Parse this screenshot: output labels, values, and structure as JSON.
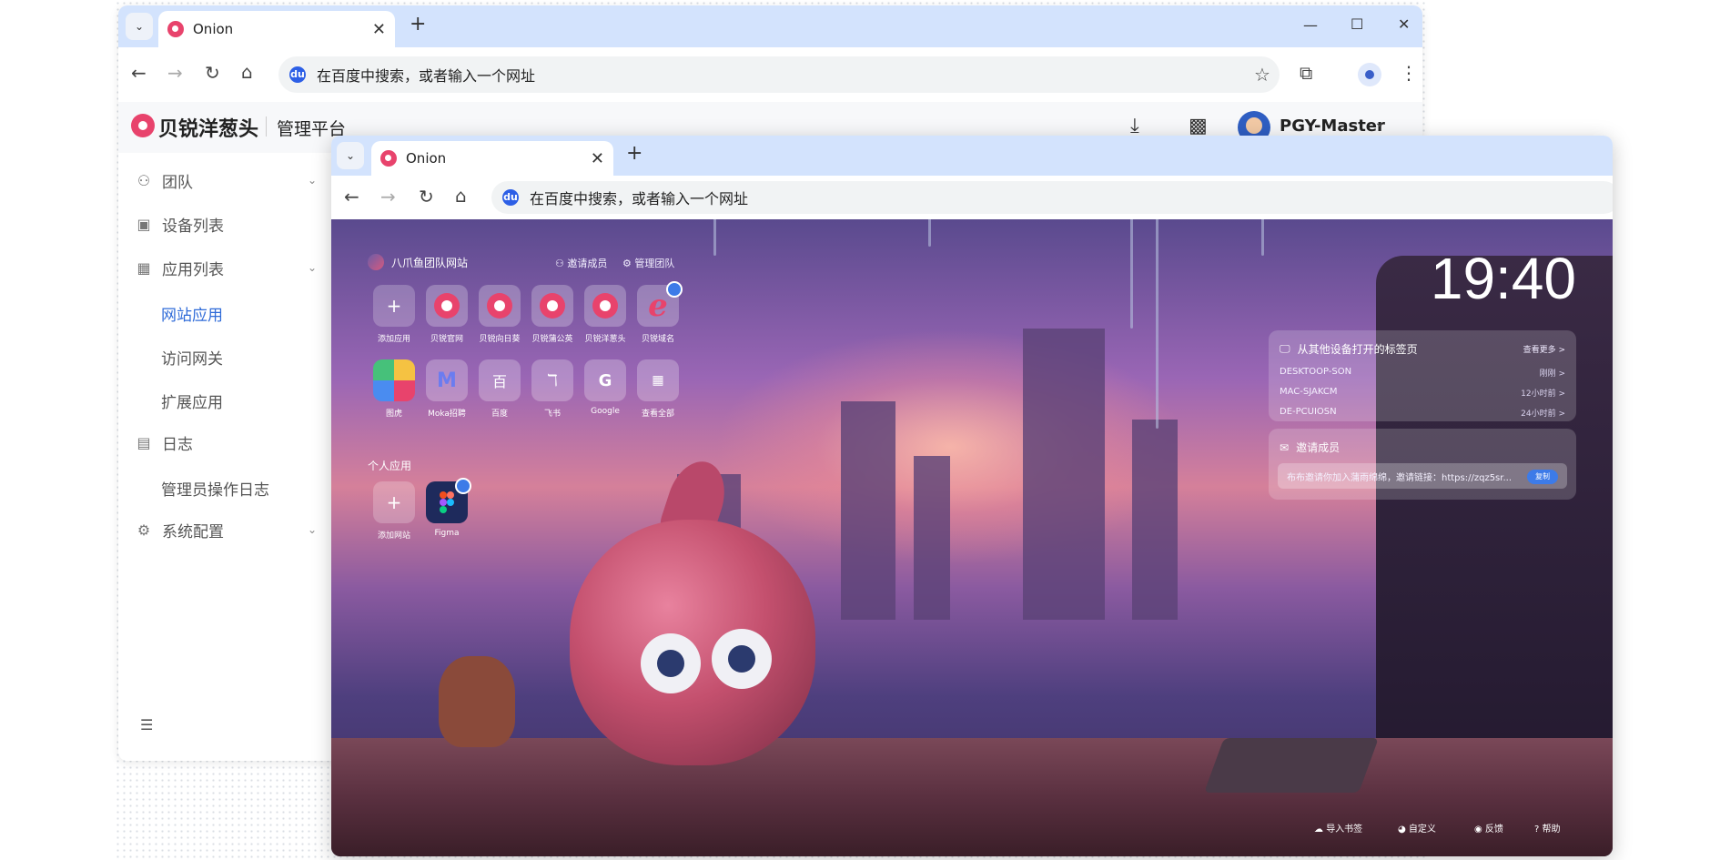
{
  "back_window": {
    "tab": {
      "title": "Onion",
      "close": "✕"
    },
    "new_tab": "+",
    "window_controls": {
      "minimize": "—",
      "maximize": "☐",
      "close": "✕"
    },
    "address_placeholder": "在百度中搜索，或者输入一个网址",
    "header": {
      "brand": "贝锐洋葱头",
      "subtitle": "管理平台",
      "user": "PGY-Master"
    },
    "sidebar": {
      "items": [
        {
          "label": "团队",
          "icon": "users-icon",
          "glyph": "⚇",
          "has_children": true
        },
        {
          "label": "设备列表",
          "icon": "devices-icon",
          "glyph": "▣",
          "has_children": false
        },
        {
          "label": "应用列表",
          "icon": "apps-icon",
          "glyph": "▦",
          "has_children": true
        }
      ],
      "sub_apps": [
        "网站应用",
        "访问网关",
        "扩展应用"
      ],
      "log": {
        "label": "日志",
        "icon": "log-icon",
        "glyph": "▤"
      },
      "sub_log": [
        "管理员操作日志"
      ],
      "config": {
        "label": "系统配置",
        "icon": "config-icon",
        "glyph": "⚙"
      }
    }
  },
  "front_window": {
    "tab": {
      "title": "Onion",
      "close": "✕"
    },
    "new_tab": "+",
    "address_placeholder": "在百度中搜索，或者输入一个网址",
    "team": {
      "name": "八爪鱼团队网站",
      "invite": "邀请成员",
      "manage": "管理团队"
    },
    "apps_row1": [
      {
        "label": "添加应用",
        "kind": "plus"
      },
      {
        "label": "贝锐官网",
        "kind": "onion"
      },
      {
        "label": "贝锐向日葵",
        "kind": "onion"
      },
      {
        "label": "贝锐蒲公英",
        "kind": "onion"
      },
      {
        "label": "贝锐洋葱头",
        "kind": "onion"
      },
      {
        "label": "贝锐域名",
        "kind": "ie"
      }
    ],
    "apps_row2": [
      {
        "label": "图虎",
        "kind": "color"
      },
      {
        "label": "Moka招聘",
        "kind": "moka"
      },
      {
        "label": "百度",
        "kind": "baidu"
      },
      {
        "label": "飞书",
        "kind": "feishu"
      },
      {
        "label": "Google",
        "kind": "google"
      },
      {
        "label": "查看全部",
        "kind": "all"
      }
    ],
    "personal_title": "个人应用",
    "personal_apps": [
      {
        "label": "添加网站",
        "kind": "plus"
      },
      {
        "label": "Figma",
        "kind": "figma"
      }
    ],
    "clock": "19:40",
    "tabs_panel": {
      "title": "从其他设备打开的标签页",
      "more": "查看更多 >",
      "devices": [
        {
          "name": "DESKTOOP-SON",
          "time": "刚刚 >"
        },
        {
          "name": "MAC-SJAKCM",
          "time": "12小时前 >"
        },
        {
          "name": "DE-PCUIOSN",
          "time": "24小时前 >"
        }
      ]
    },
    "invite_panel": {
      "title": "邀请成员",
      "text": "布布邀请你加入蒲雨绵绵，邀请链接：https://zqz5sr...",
      "copy": "复制"
    },
    "footer": [
      {
        "label": "导入书签",
        "icon": "cloud-icon"
      },
      {
        "label": "自定义",
        "icon": "palette-icon"
      },
      {
        "label": "反馈",
        "icon": "feedback-icon"
      },
      {
        "label": "帮助",
        "icon": "help-icon"
      }
    ]
  }
}
